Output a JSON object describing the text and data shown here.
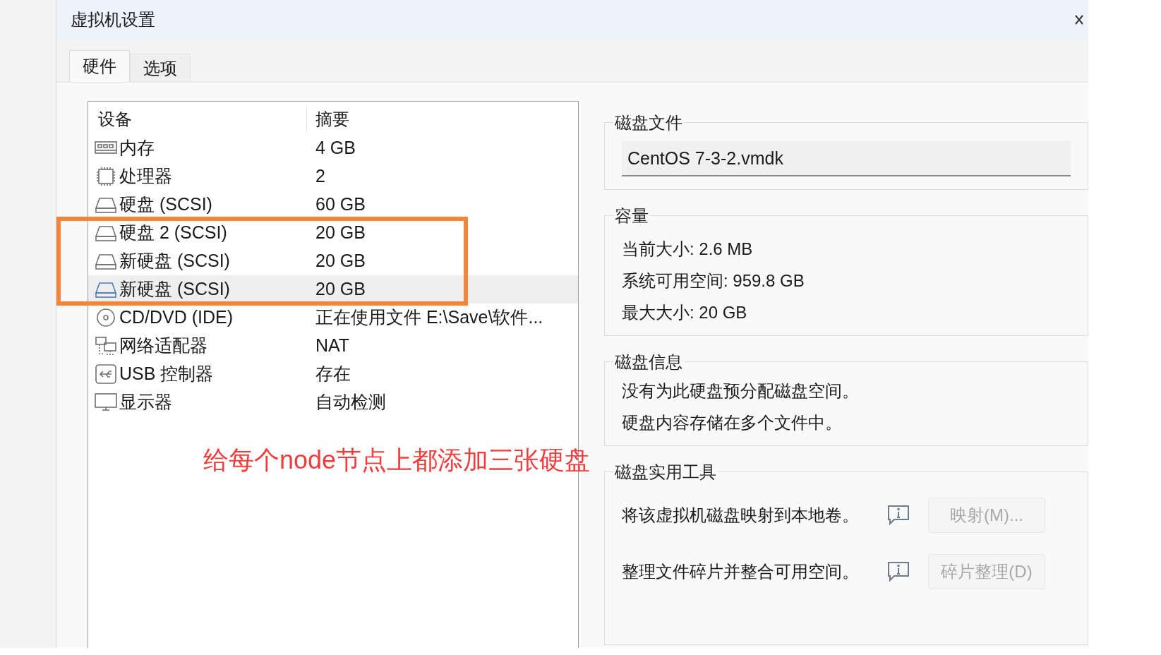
{
  "window": {
    "title": "虚拟机设置"
  },
  "tabs": [
    {
      "label": "硬件",
      "selected": true
    },
    {
      "label": "选项",
      "selected": false
    }
  ],
  "device_list": {
    "columns": [
      "设备",
      "摘要"
    ],
    "rows": [
      {
        "kind": "memory",
        "device": "内存",
        "summary": "4 GB",
        "selected": false
      },
      {
        "kind": "cpu",
        "device": "处理器",
        "summary": "2",
        "selected": false
      },
      {
        "kind": "disk",
        "device": "硬盘 (SCSI)",
        "summary": "60 GB",
        "selected": false
      },
      {
        "kind": "disk",
        "device": "硬盘 2 (SCSI)",
        "summary": "20 GB",
        "selected": false
      },
      {
        "kind": "disk",
        "device": "新硬盘 (SCSI)",
        "summary": "20 GB",
        "selected": false
      },
      {
        "kind": "disk",
        "device": "新硬盘 (SCSI)",
        "summary": "20 GB",
        "selected": true
      },
      {
        "kind": "cdrom",
        "device": "CD/DVD (IDE)",
        "summary": "正在使用文件 E:\\Save\\软件...",
        "selected": false
      },
      {
        "kind": "network",
        "device": "网络适配器",
        "summary": "NAT",
        "selected": false
      },
      {
        "kind": "usb",
        "device": "USB 控制器",
        "summary": "存在",
        "selected": false
      },
      {
        "kind": "display",
        "device": "显示器",
        "summary": "自动检测",
        "selected": false
      }
    ]
  },
  "disk_file": {
    "title": "磁盘文件",
    "value": "CentOS 7-3-2.vmdk"
  },
  "capacity": {
    "title": "容量",
    "lines": [
      "当前大小: 2.6 MB",
      "系统可用空间: 959.8 GB",
      "最大大小: 20 GB"
    ]
  },
  "disk_info": {
    "title": "磁盘信息",
    "lines": [
      "没有为此硬盘预分配磁盘空间。",
      "硬盘内容存储在多个文件中。"
    ]
  },
  "disk_utilities": {
    "title": "磁盘实用工具",
    "actions": [
      {
        "description": "将该虚拟机磁盘映射到本地卷。",
        "button": "映射(M)...",
        "disabled": true
      },
      {
        "description": "整理文件碎片并整合可用空间。",
        "button": "碎片整理(D)",
        "disabled": true
      }
    ]
  },
  "annotation": {
    "note": "给每个node节点上都添加三张硬盘"
  }
}
